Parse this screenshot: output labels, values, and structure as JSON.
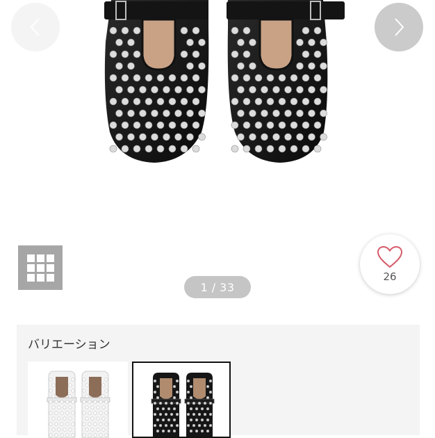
{
  "gallery": {
    "counter": "1 / 33"
  },
  "favorite": {
    "count": "26",
    "icon": "heart-icon",
    "color": "#d65a6a"
  },
  "nav": {
    "prev_icon": "chevron-left-icon",
    "next_icon": "chevron-right-icon"
  },
  "grid_button": {
    "icon": "grid-icon"
  },
  "variation": {
    "title": "バリエーション",
    "items": [
      {
        "color": "white",
        "selected": false
      },
      {
        "color": "black",
        "selected": true
      }
    ]
  }
}
